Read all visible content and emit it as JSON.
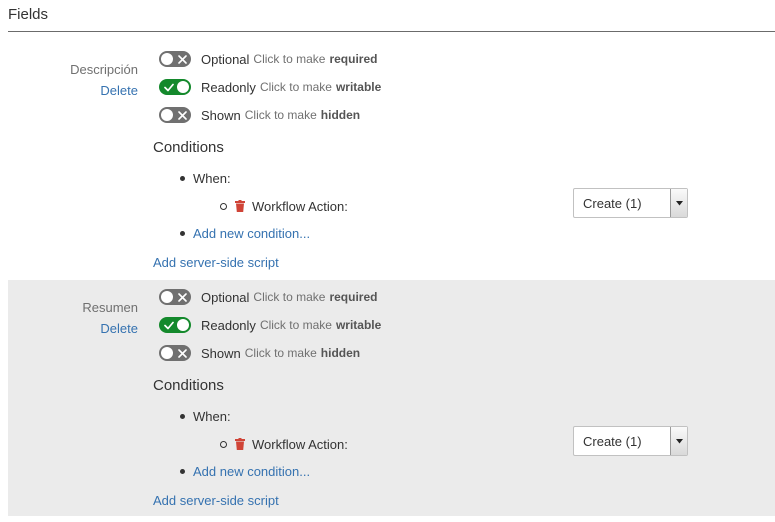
{
  "section": {
    "title": "Fields"
  },
  "fields": [
    {
      "name": "Descripción",
      "delete_label": "Delete",
      "toggles": [
        {
          "label": "Optional",
          "hint": "Click to make",
          "action": "required",
          "on": false
        },
        {
          "label": "Readonly",
          "hint": "Click to make",
          "action": "writable",
          "on": true
        },
        {
          "label": "Shown",
          "hint": "Click to make",
          "action": "hidden",
          "on": false
        }
      ],
      "conditions": {
        "title": "Conditions",
        "when_label": "When:",
        "workflow_label": "Workflow Action:",
        "workflow_value": "Create (1)",
        "add_condition": "Add new condition..."
      },
      "add_script": "Add server-side script"
    },
    {
      "name": "Resumen",
      "delete_label": "Delete",
      "toggles": [
        {
          "label": "Optional",
          "hint": "Click to make",
          "action": "required",
          "on": false
        },
        {
          "label": "Readonly",
          "hint": "Click to make",
          "action": "writable",
          "on": true
        },
        {
          "label": "Shown",
          "hint": "Click to make",
          "action": "hidden",
          "on": false
        }
      ],
      "conditions": {
        "title": "Conditions",
        "when_label": "When:",
        "workflow_label": "Workflow Action:",
        "workflow_value": "Create (1)",
        "add_condition": "Add new condition..."
      },
      "add_script": "Add server-side script"
    }
  ],
  "colors": {
    "link": "#3572b0",
    "toggle_on": "#14892c",
    "toggle_off": "#707070",
    "delete_icon": "#d04437",
    "alt_row_bg": "#ebebeb"
  },
  "icons": {
    "toggle_off": "x-icon",
    "toggle_on": "check-icon",
    "remove_condition": "trash-icon",
    "select_arrow": "caret-down-icon"
  }
}
